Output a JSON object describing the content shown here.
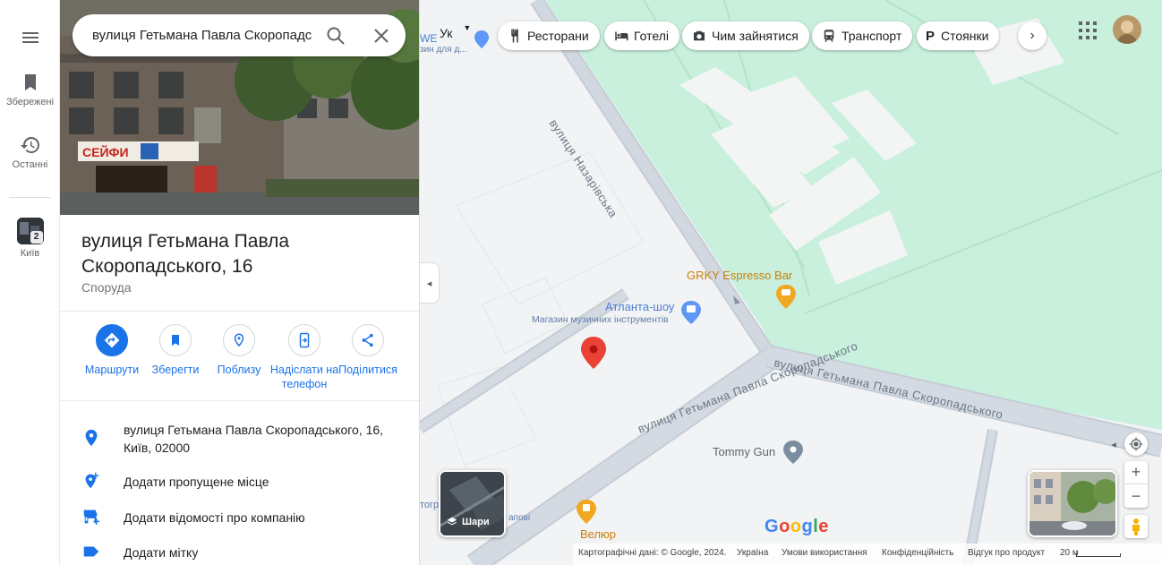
{
  "search": {
    "value": "вулиця Гетьмана Павла Скоропадс"
  },
  "rail": {
    "saved_label": "Збережені",
    "recent_label": "Останні",
    "city_label": "Київ",
    "city_badge": "2"
  },
  "place": {
    "title": "вулиця Гетьмана Павла Скоропадського, 16",
    "category": "Споруда",
    "photo_sign": "СЕЙФИ"
  },
  "actions": [
    {
      "label": "Маршрути"
    },
    {
      "label": "Зберегти"
    },
    {
      "label": "Поблизу"
    },
    {
      "label": "Надіслати на телефон"
    },
    {
      "label": "Поділитися"
    }
  ],
  "info": {
    "address": "вулиця Гетьмана Павла Скоропадського, 16, Київ, 02000",
    "add_missing_place": "Додати пропущене місце",
    "add_business": "Додати відомості про компанію",
    "add_label": "Додати мітку"
  },
  "chips": {
    "language": "Ук",
    "restaurants": "Ресторани",
    "hotels": "Готелі",
    "things_to_do": "Чим зайнятися",
    "transit": "Транспорт",
    "parking": "Стоянки"
  },
  "map": {
    "street_nazarivska": "вулиця Назарівська",
    "street_skoropadskoho": "вулиця Гетьмана Павла Скоропадського",
    "poi_cafe": "GRKY Espresso Bar",
    "poi_music_name": "Атланта-шоу",
    "poi_music_desc": "Магазин музичних інструментів",
    "poi_tommy": "Tommy Gun",
    "poi_velur": "Велюр",
    "partial_we": "WE",
    "partial_we2": "зин для д...",
    "partial_torh": "тогр",
    "partial_pov": "апові",
    "layers_label": "Шари",
    "google_logo": "Google",
    "colors": {
      "park": "#c8f0dc",
      "road": "#c5ccd6",
      "building": "#f8f9fa",
      "pin": "#ea4335",
      "accent": "#1a73e8"
    }
  },
  "footer": {
    "map_data": "Картографічні дані: © Google, 2024.",
    "country": "Україна",
    "terms": "Умови використання",
    "privacy": "Конфіденційність",
    "feedback": "Відгук про продукт",
    "scale": "20 м"
  }
}
